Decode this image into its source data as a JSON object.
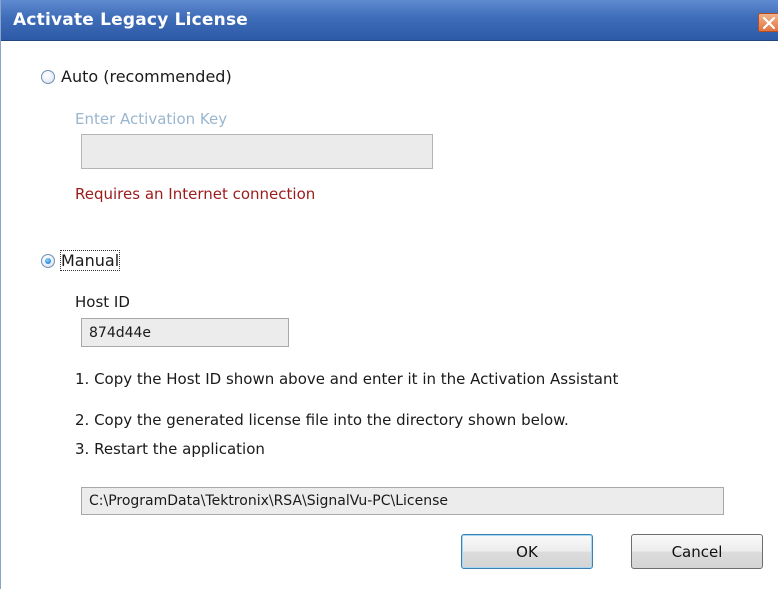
{
  "window": {
    "title": "Activate Legacy License"
  },
  "auto": {
    "label": "Auto (recommended)",
    "selected": false,
    "key_label": "Enter Activation Key",
    "key_value": "",
    "note": "Requires an Internet connection"
  },
  "manual": {
    "label": "Manual",
    "selected": true,
    "host_id_label": "Host ID",
    "host_id_value": "874d44e",
    "steps": [
      "1. Copy the Host ID shown above and enter it in the Activation Assistant",
      "2. Copy the generated license file into the directory shown below.",
      "3. Restart the application"
    ],
    "license_path": "C:\\ProgramData\\Tektronix\\RSA\\SignalVu-PC\\License"
  },
  "buttons": {
    "ok": "OK",
    "cancel": "Cancel"
  },
  "colors": {
    "titlebar": "#3f6cb8",
    "warning_text": "#9b1b1b",
    "disabled_text": "#9ab6cf"
  },
  "icons": {
    "close": "close-icon"
  }
}
